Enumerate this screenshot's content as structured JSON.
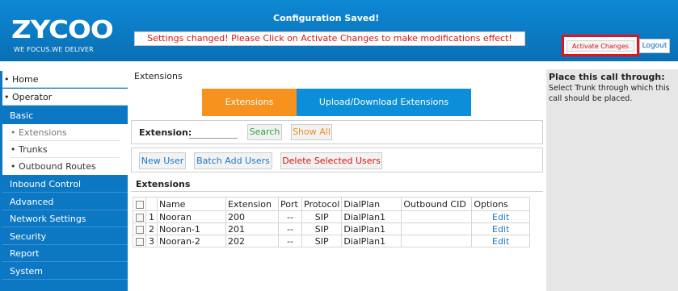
{
  "header": {
    "logo_text": "ZYCOO",
    "logo_tagline": "WE FOCUS.WE DELIVER",
    "config_saved": "Configuration Saved!",
    "notice": "Settings changed! Please Click on Activate Changes to make modifications effect!",
    "activate_label": "Activate Changes",
    "logout_label": "Logout"
  },
  "sidebar": {
    "items": [
      {
        "label": "• Home"
      },
      {
        "label": "• Operator"
      },
      {
        "label": "Basic"
      },
      {
        "label": "• Extensions"
      },
      {
        "label": "• Trunks"
      },
      {
        "label": "• Outbound Routes"
      },
      {
        "label": "Inbound Control"
      },
      {
        "label": "Advanced"
      },
      {
        "label": "Network Settings"
      },
      {
        "label": "Security"
      },
      {
        "label": "Report"
      },
      {
        "label": "System"
      }
    ]
  },
  "main": {
    "breadcrumb": "Extensions",
    "tabs": [
      {
        "label": "Extensions",
        "active": true
      },
      {
        "label": "Upload/Download Extensions",
        "active": false
      }
    ],
    "filter": {
      "label": "Extension:",
      "value": "",
      "search_label": "Search",
      "showall_label": "Show All"
    },
    "actions": {
      "new_user": "New User",
      "batch_add": "Batch Add Users",
      "delete_selected": "Delete Selected Users"
    },
    "section_title": "Extensions",
    "table": {
      "columns": [
        "",
        "",
        "Name",
        "Extension",
        "Port",
        "Protocol",
        "DialPlan",
        "Outbound CID",
        "Options"
      ],
      "rows": [
        {
          "index": "1",
          "name": "Nooran",
          "extension": "200",
          "port": "--",
          "protocol": "SIP",
          "dialplan": "DialPlan1",
          "outbound_cid": "",
          "option": "Edit"
        },
        {
          "index": "2",
          "name": "Nooran-1",
          "extension": "201",
          "port": "--",
          "protocol": "SIP",
          "dialplan": "DialPlan1",
          "outbound_cid": "",
          "option": "Edit"
        },
        {
          "index": "3",
          "name": "Nooran-2",
          "extension": "202",
          "port": "--",
          "protocol": "SIP",
          "dialplan": "DialPlan1",
          "outbound_cid": "",
          "option": "Edit"
        }
      ]
    }
  },
  "help_panel": {
    "title": "Place this call through:",
    "text": "Select Trunk through which this call should be placed."
  },
  "colors": {
    "header_blue": "#0a78c4",
    "sidebar_blue": "#0c78c4",
    "tab_orange": "#f7921e",
    "tab_blue": "#0d8ed9",
    "alert_red": "#d4150e"
  }
}
